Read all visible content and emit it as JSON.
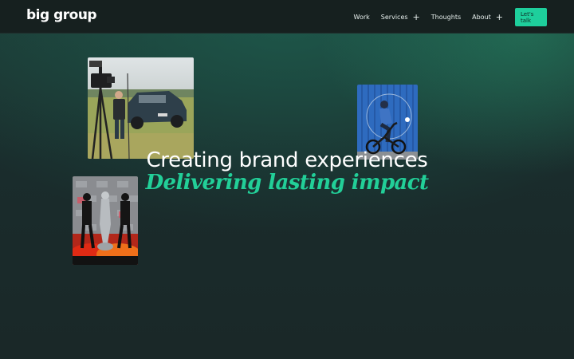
{
  "brand": {
    "name": "big group"
  },
  "nav": {
    "items": [
      {
        "label": "Work",
        "has_submenu": false
      },
      {
        "label": "Services",
        "has_submenu": true
      },
      {
        "label": "Thoughts",
        "has_submenu": false
      },
      {
        "label": "About",
        "has_submenu": true
      }
    ],
    "cta_label": "Let's talk",
    "expand_glyph": "+"
  },
  "hero": {
    "title": "Creating brand experiences",
    "subtitle": "Delivering lasting impact"
  },
  "colors": {
    "accent": "#1ecf9c",
    "subtitle": "#22cf98",
    "nav_bg": "#16201f",
    "page_bg": "#1a2828"
  },
  "images": [
    {
      "name": "film-crew-car-photo"
    },
    {
      "name": "ebike-rider-photo"
    },
    {
      "name": "award-statue-event-photo"
    }
  ]
}
